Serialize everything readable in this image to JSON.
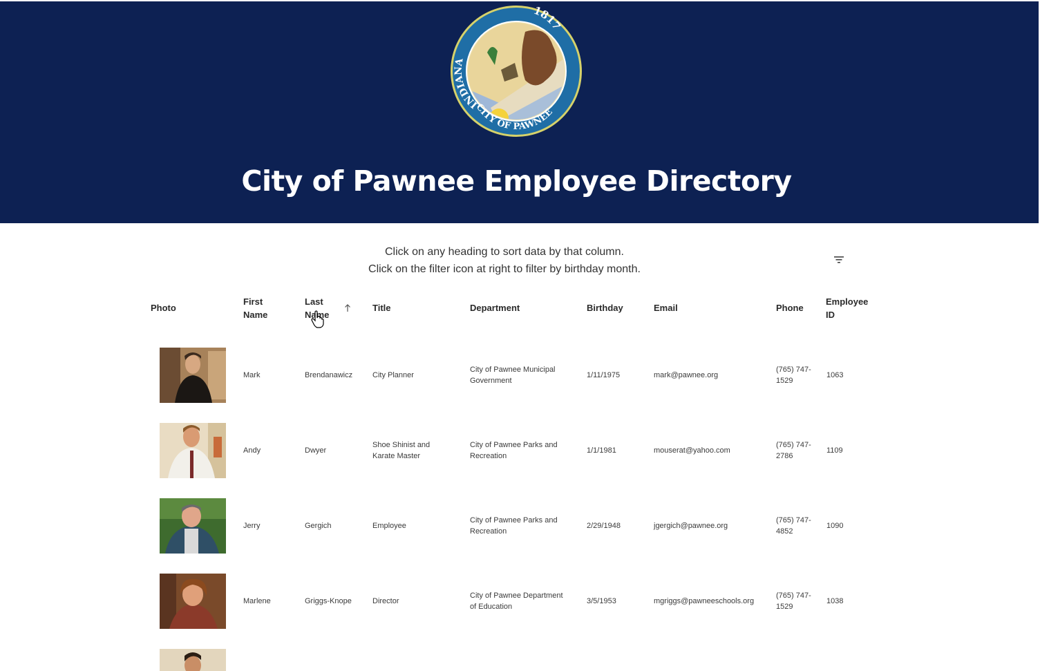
{
  "header": {
    "seal": {
      "top_text": "1817",
      "left_text": "INDIANA",
      "bottom_text": "CITY OF PAWNEE"
    },
    "title": "City of Pawnee Employee Directory"
  },
  "instructions": {
    "line1": "Click on any heading to sort data by that column.",
    "line2": "Click on the filter icon at right to filter by birthday month."
  },
  "filter_icon": "filter-list-icon",
  "table": {
    "columns": {
      "photo": "Photo",
      "first_name": "First Name",
      "last_name": "Last Name",
      "title": "Title",
      "department": "Department",
      "birthday": "Birthday",
      "email": "Email",
      "phone": "Phone",
      "employee_id": "Employee ID"
    },
    "sort": {
      "column": "Last Name",
      "direction": "ascending"
    },
    "rows": [
      {
        "first": "Mark",
        "last": "Brendanawicz",
        "title": "City Planner",
        "department": "City of Pawnee Municipal Government",
        "birthday": "1/11/1975",
        "email": "mark@pawnee.org",
        "phone": "(765) 747-1529",
        "id": "1063"
      },
      {
        "first": "Andy",
        "last": "Dwyer",
        "title": "Shoe Shinist and Karate Master",
        "department": "City of Pawnee Parks and Recreation",
        "birthday": "1/1/1981",
        "email": "mouserat@yahoo.com",
        "phone": "(765) 747-2786",
        "id": "1109"
      },
      {
        "first": "Jerry",
        "last": "Gergich",
        "title": "Employee",
        "department": "City of Pawnee Parks and Recreation",
        "birthday": "2/29/1948",
        "email": "jgergich@pawnee.org",
        "phone": "(765) 747-4852",
        "id": "1090"
      },
      {
        "first": "Marlene",
        "last": "Griggs-Knope",
        "title": "Director",
        "department": "City of Pawnee Department of Education",
        "birthday": "3/5/1953",
        "email": "mgriggs@pawneeschools.org",
        "phone": "(765) 747-1529",
        "id": "1038"
      }
    ]
  },
  "colors": {
    "header_bg": "#0d2153",
    "seal_ring": "#1e6fa8",
    "seal_gold": "#e8d08f"
  }
}
